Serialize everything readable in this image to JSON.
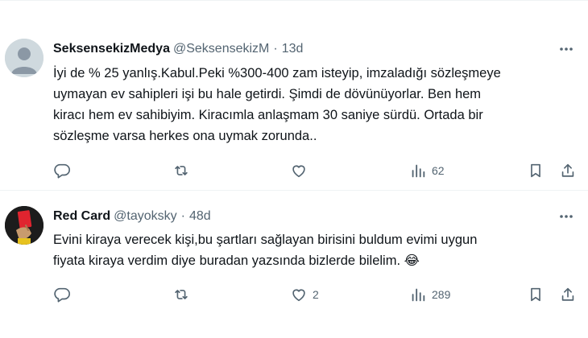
{
  "tweets": [
    {
      "author_name": "SeksensekizMedya",
      "handle": "@SeksensekizM",
      "separator": "·",
      "time": "13d",
      "text": "İyi de % 25 yanlış.Kabul.Peki %300-400 zam isteyip, imzaladığı sözleşmeye\nuymayan ev sahipleri işi bu hale getirdi. Şimdi de dövünüyorlar. Ben hem\nkiracı hem ev sahibiyim. Kiracımla anlaşmam 30 saniye sürdü. Ortada bir\nsözleşme varsa herkes ona uymak zorunda..",
      "reply_count": "",
      "retweet_count": "",
      "like_count": "",
      "view_count": "62",
      "avatar_icon": "default-avatar-icon"
    },
    {
      "author_name": "Red Card",
      "handle": "@tayoksky",
      "separator": "·",
      "time": "48d",
      "text": "Evini kiraya verecek kişi,bu şartları sağlayan birisini buldum evimi uygun\nfiyata kiraya verdim diye buradan yazsında bizlerde bilelim. 😂",
      "reply_count": "",
      "retweet_count": "",
      "like_count": "2",
      "view_count": "289",
      "avatar_icon": "red-card-avatar-icon"
    }
  ],
  "colors": {
    "text": "#0f1419",
    "secondary": "#536471",
    "divider": "#eff3f4",
    "red_card": "#e0242f"
  },
  "icons": [
    "reply-icon",
    "retweet-icon",
    "like-icon",
    "views-icon",
    "bookmark-icon",
    "share-icon",
    "more-icon"
  ]
}
